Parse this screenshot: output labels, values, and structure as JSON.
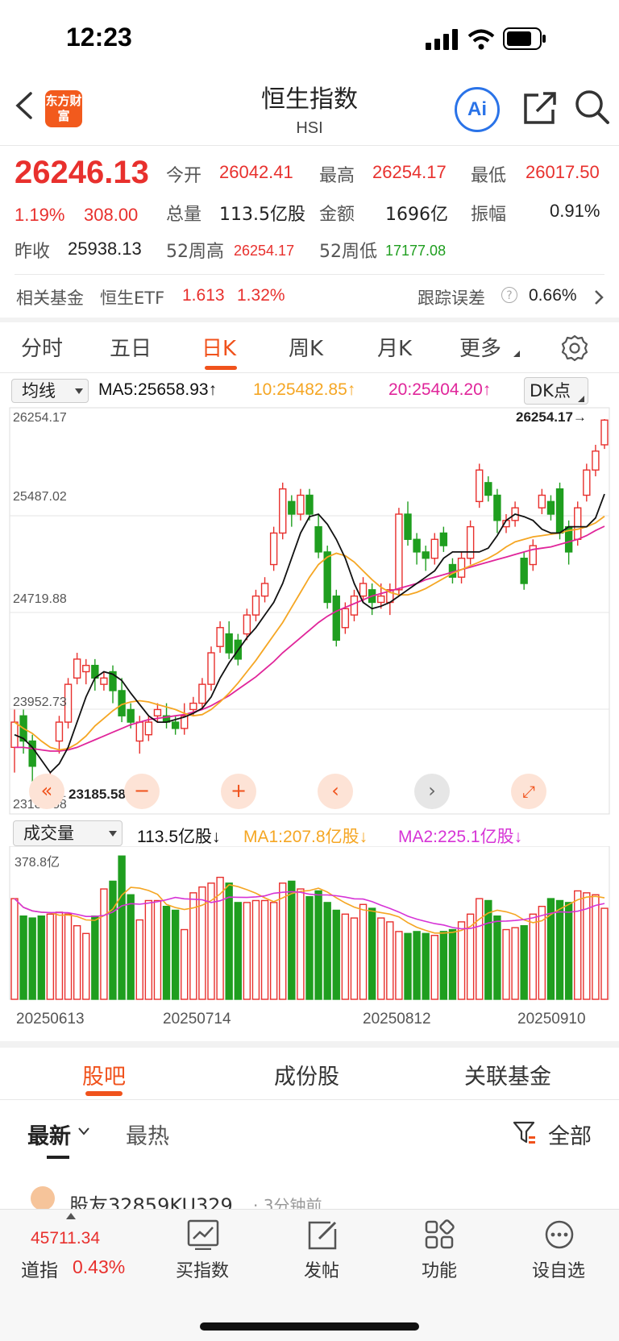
{
  "status_bar": {
    "time": "12:23"
  },
  "header": {
    "title": "恒生指数",
    "subtitle": "HSI",
    "logo_text": "东方财富",
    "ai_label": "Ai"
  },
  "quote": {
    "price": "26246.13",
    "change_pct": "1.19%",
    "change": "308.00",
    "open_label": "今开",
    "open": "26042.41",
    "high_label": "最高",
    "high": "26254.17",
    "low_label": "最低",
    "low": "26017.50",
    "volume_label": "总量",
    "volume": "113.5亿股",
    "amount_label": "金额",
    "amount": "1696亿",
    "amplitude_label": "振幅",
    "amplitude": "0.91%",
    "prev_close_label": "昨收",
    "prev_close": "25938.13",
    "w52_high_label": "52周高",
    "w52_high": "26254.17",
    "w52_low_label": "52周低",
    "w52_low": "17177.08"
  },
  "fund": {
    "label": "相关基金",
    "name": "恒生ETF",
    "price": "1.613",
    "change": "1.32%",
    "tracking_label": "跟踪误差",
    "tracking_value": "0.66%"
  },
  "period_tabs": [
    "分时",
    "五日",
    "日K",
    "周K",
    "月K",
    "更多"
  ],
  "active_tab": "日K",
  "ma_bar": {
    "selector": "均线",
    "ma5": "MA5:25658.93↑",
    "ma10": "10:25482.85↑",
    "ma20": "20:25404.20↑",
    "dk": "DK点"
  },
  "price_axis": [
    "26254.17",
    "25487.02",
    "24719.88",
    "23952.73",
    "23185.58"
  ],
  "annotations": {
    "high_mark": "26254.17→",
    "low_mark": "←23185.58"
  },
  "volume_bar": {
    "selector": "成交量",
    "vol": "113.5亿股↓",
    "ma1": "MA1:207.8亿股↓",
    "ma2": "MA2:225.1亿股↓",
    "axis_max": "378.8亿"
  },
  "dates": [
    "20250613",
    "20250714",
    "20250812",
    "20250910"
  ],
  "colors": {
    "up": "#e8302d",
    "down": "#1f9e1f",
    "ma5": "#111111",
    "ma10": "#f5a623",
    "ma20": "#e0259a",
    "accent": "#f0521c"
  },
  "chart_data": {
    "type": "candlestick",
    "ylim": [
      23185.58,
      26254.17
    ],
    "candles": [
      {
        "o": 23650,
        "c": 23850,
        "h": 23950,
        "l": 23450
      },
      {
        "o": 23900,
        "c": 23700,
        "h": 23950,
        "l": 23600
      },
      {
        "o": 23700,
        "c": 23500,
        "h": 23750,
        "l": 23350
      },
      {
        "o": 23350,
        "c": 23200,
        "h": 23400,
        "l": 23190
      },
      {
        "o": 23200,
        "c": 23350,
        "h": 23450,
        "l": 23186
      },
      {
        "o": 23700,
        "c": 23850,
        "h": 23900,
        "l": 23600
      },
      {
        "o": 23850,
        "c": 24150,
        "h": 24200,
        "l": 23800
      },
      {
        "o": 24200,
        "c": 24350,
        "h": 24400,
        "l": 24150
      },
      {
        "o": 24250,
        "c": 24300,
        "h": 24350,
        "l": 24150
      },
      {
        "o": 24300,
        "c": 24200,
        "h": 24350,
        "l": 24100
      },
      {
        "o": 24150,
        "c": 24200,
        "h": 24250,
        "l": 24100
      },
      {
        "o": 24250,
        "c": 24100,
        "h": 24300,
        "l": 24000
      },
      {
        "o": 24100,
        "c": 23900,
        "h": 24200,
        "l": 23850
      },
      {
        "o": 23950,
        "c": 23850,
        "h": 24000,
        "l": 23800
      },
      {
        "o": 23700,
        "c": 23850,
        "h": 23900,
        "l": 23600
      },
      {
        "o": 23750,
        "c": 23850,
        "h": 23900,
        "l": 23700
      },
      {
        "o": 23900,
        "c": 23950,
        "h": 24000,
        "l": 23850
      },
      {
        "o": 23900,
        "c": 23850,
        "h": 24000,
        "l": 23800
      },
      {
        "o": 23850,
        "c": 23800,
        "h": 23900,
        "l": 23750
      },
      {
        "o": 23800,
        "c": 23900,
        "h": 24000,
        "l": 23750
      },
      {
        "o": 23950,
        "c": 24000,
        "h": 24050,
        "l": 23900
      },
      {
        "o": 24000,
        "c": 24150,
        "h": 24200,
        "l": 23950
      },
      {
        "o": 24150,
        "c": 24400,
        "h": 24450,
        "l": 24100
      },
      {
        "o": 24450,
        "c": 24600,
        "h": 24650,
        "l": 24400
      },
      {
        "o": 24550,
        "c": 24400,
        "h": 24650,
        "l": 24350
      },
      {
        "o": 24500,
        "c": 24350,
        "h": 24550,
        "l": 24300
      },
      {
        "o": 24550,
        "c": 24700,
        "h": 24750,
        "l": 24500
      },
      {
        "o": 24700,
        "c": 24850,
        "h": 24900,
        "l": 24650
      },
      {
        "o": 24850,
        "c": 24950,
        "h": 25000,
        "l": 24800
      },
      {
        "o": 25100,
        "c": 25350,
        "h": 25400,
        "l": 25050
      },
      {
        "o": 25350,
        "c": 25700,
        "h": 25750,
        "l": 25300
      },
      {
        "o": 25600,
        "c": 25500,
        "h": 25650,
        "l": 25400
      },
      {
        "o": 25500,
        "c": 25650,
        "h": 25700,
        "l": 25450
      },
      {
        "o": 25650,
        "c": 25500,
        "h": 25700,
        "l": 25450
      },
      {
        "o": 25400,
        "c": 25200,
        "h": 25500,
        "l": 25150
      },
      {
        "o": 25200,
        "c": 24800,
        "h": 25250,
        "l": 24750
      },
      {
        "o": 24850,
        "c": 24500,
        "h": 24900,
        "l": 24450
      },
      {
        "o": 24600,
        "c": 24750,
        "h": 24800,
        "l": 24550
      },
      {
        "o": 24700,
        "c": 24850,
        "h": 24900,
        "l": 24650
      },
      {
        "o": 24850,
        "c": 24950,
        "h": 25000,
        "l": 24800
      },
      {
        "o": 24900,
        "c": 24800,
        "h": 24950,
        "l": 24700
      },
      {
        "o": 24800,
        "c": 24850,
        "h": 24950,
        "l": 24750
      },
      {
        "o": 24800,
        "c": 24900,
        "h": 24950,
        "l": 24700
      },
      {
        "o": 24900,
        "c": 25500,
        "h": 25550,
        "l": 24850
      },
      {
        "o": 25500,
        "c": 25300,
        "h": 25600,
        "l": 25250
      },
      {
        "o": 25300,
        "c": 25200,
        "h": 25350,
        "l": 25100
      },
      {
        "o": 25200,
        "c": 25150,
        "h": 25250,
        "l": 25050
      },
      {
        "o": 25150,
        "c": 25300,
        "h": 25350,
        "l": 25100
      },
      {
        "o": 25350,
        "c": 25250,
        "h": 25400,
        "l": 25200
      },
      {
        "o": 25100,
        "c": 25000,
        "h": 25150,
        "l": 24950
      },
      {
        "o": 25000,
        "c": 25150,
        "h": 25200,
        "l": 24950
      },
      {
        "o": 25150,
        "c": 25400,
        "h": 25450,
        "l": 25100
      },
      {
        "o": 25600,
        "c": 25850,
        "h": 25900,
        "l": 25550
      },
      {
        "o": 25750,
        "c": 25650,
        "h": 25800,
        "l": 25600
      },
      {
        "o": 25650,
        "c": 25450,
        "h": 25700,
        "l": 25350
      },
      {
        "o": 25400,
        "c": 25450,
        "h": 25500,
        "l": 25350
      },
      {
        "o": 25450,
        "c": 25550,
        "h": 25600,
        "l": 25400
      },
      {
        "o": 25150,
        "c": 24950,
        "h": 25200,
        "l": 24900
      },
      {
        "o": 25100,
        "c": 25250,
        "h": 25300,
        "l": 25050
      },
      {
        "o": 25550,
        "c": 25650,
        "h": 25700,
        "l": 25500
      },
      {
        "o": 25600,
        "c": 25500,
        "h": 25650,
        "l": 25450
      },
      {
        "o": 25700,
        "c": 25350,
        "h": 25750,
        "l": 25300
      },
      {
        "o": 25400,
        "c": 25200,
        "h": 25450,
        "l": 25100
      },
      {
        "o": 25300,
        "c": 25550,
        "h": 25600,
        "l": 25250
      },
      {
        "o": 25650,
        "c": 25850,
        "h": 25900,
        "l": 25600
      },
      {
        "o": 25850,
        "c": 26000,
        "h": 26050,
        "l": 25800
      },
      {
        "o": 26050,
        "c": 26246,
        "h": 26254,
        "l": 26017
      }
    ],
    "ma5": [
      23750,
      23720,
      23650,
      23550,
      23450,
      23520,
      23650,
      23850,
      24050,
      24200,
      24250,
      24230,
      24180,
      24080,
      23990,
      23900,
      23850,
      23850,
      23870,
      23890,
      23920,
      23960,
      24050,
      24200,
      24320,
      24420,
      24520,
      24600,
      24700,
      24800,
      24950,
      25150,
      25350,
      25480,
      25500,
      25420,
      25300,
      25150,
      24950,
      24800,
      24750,
      24770,
      24800,
      24850,
      24900,
      24950,
      25000,
      25050,
      25150,
      25200,
      25200,
      25200,
      25200,
      25230,
      25330,
      25450,
      25500,
      25480,
      25450,
      25380,
      25350,
      25350,
      25400,
      25400,
      25400,
      25470,
      25659
    ],
    "ma10": [
      23850,
      23800,
      23760,
      23700,
      23650,
      23630,
      23640,
      23680,
      23740,
      23820,
      23880,
      23940,
      23990,
      24010,
      24020,
      24010,
      23990,
      23970,
      23950,
      23920,
      23900,
      23910,
      23950,
      24010,
      24080,
      24160,
      24250,
      24340,
      24440,
      24540,
      24640,
      24760,
      24880,
      25000,
      25100,
      25160,
      25190,
      25170,
      25120,
      25050,
      24980,
      24920,
      24880,
      24860,
      24860,
      24880,
      24910,
      24950,
      24990,
      25030,
      25060,
      25090,
      25120,
      25150,
      25190,
      25240,
      25280,
      25300,
      25320,
      25330,
      25340,
      25350,
      25370,
      25380,
      25400,
      25430,
      25483
    ],
    "ma20": [
      23650,
      23650,
      23640,
      23630,
      23620,
      23620,
      23630,
      23650,
      23680,
      23710,
      23740,
      23770,
      23800,
      23830,
      23850,
      23870,
      23880,
      23890,
      23900,
      23910,
      23930,
      23950,
      23980,
      24020,
      24060,
      24110,
      24160,
      24210,
      24270,
      24330,
      24400,
      24460,
      24520,
      24580,
      24640,
      24690,
      24730,
      24760,
      24790,
      24820,
      24850,
      24870,
      24890,
      24910,
      24930,
      24950,
      24980,
      25000,
      25020,
      25040,
      25060,
      25080,
      25100,
      25120,
      25140,
      25160,
      25180,
      25200,
      25220,
      25230,
      25240,
      25260,
      25280,
      25300,
      25330,
      25370,
      25404
    ],
    "volume_ylim": [
      0,
      378.8
    ],
    "volume": [
      260,
      215,
      210,
      215,
      220,
      225,
      220,
      190,
      170,
      215,
      285,
      305,
      370,
      270,
      205,
      255,
      255,
      240,
      230,
      180,
      275,
      290,
      300,
      315,
      300,
      250,
      250,
      255,
      255,
      250,
      300,
      305,
      285,
      265,
      280,
      250,
      230,
      220,
      210,
      245,
      235,
      210,
      200,
      175,
      170,
      175,
      170,
      165,
      175,
      180,
      200,
      220,
      260,
      255,
      215,
      180,
      185,
      190,
      220,
      240,
      260,
      255,
      250,
      280,
      275,
      270,
      235
    ]
  },
  "bottom_tabs": [
    "股吧",
    "成份股",
    "关联基金"
  ],
  "active_bottom_tab": "股吧",
  "feed_filters": {
    "latest": "最新",
    "hot": "最热",
    "all": "全部"
  },
  "post_preview": {
    "user": "股友32859KU329",
    "time": "· 3分钟前"
  },
  "footer": {
    "dow_value": "45711.34",
    "dow_label": "道指",
    "dow_change": "0.43%",
    "nav": [
      "买指数",
      "发帖",
      "功能",
      "设自选"
    ]
  }
}
